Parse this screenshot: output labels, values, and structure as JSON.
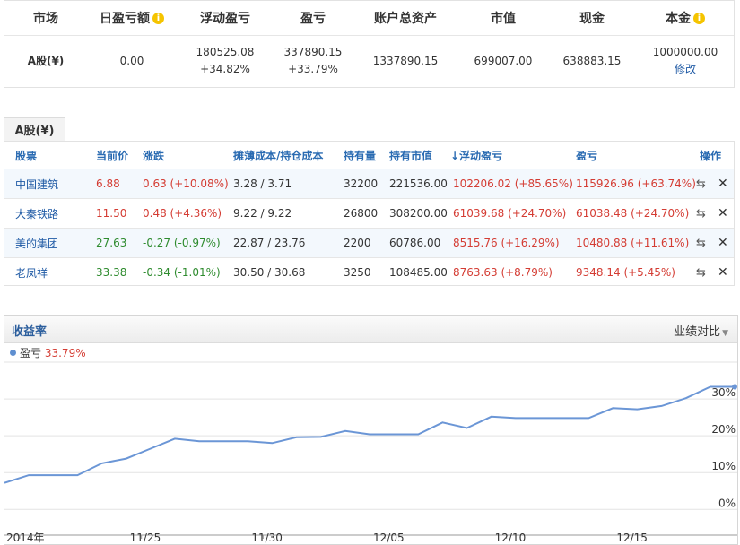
{
  "summary": {
    "headers": {
      "market": "市场",
      "daily_pnl": "日盈亏额",
      "floating_pnl": "浮动盈亏",
      "pnl": "盈亏",
      "total_assets": "账户总资产",
      "market_value": "市值",
      "cash": "现金",
      "principal": "本金"
    },
    "info_icon": "i",
    "row": {
      "market": "A股(¥)",
      "daily_pnl": "0.00",
      "floating_pnl": "180525.08",
      "floating_pnl_pct": "+34.82%",
      "pnl": "337890.15",
      "pnl_pct": "+33.79%",
      "total_assets": "1337890.15",
      "market_value": "699007.00",
      "cash": "638883.15",
      "principal": "1000000.00",
      "edit_link": "修改"
    }
  },
  "holdings": {
    "tab_label": "A股(¥)",
    "columns": {
      "stock": "股票",
      "price": "当前价",
      "change": "涨跌",
      "cost": "摊薄成本/持仓成本",
      "quantity": "持有量",
      "holding_value": "持有市值",
      "floating_pnl": "↓浮动盈亏",
      "pnl": "盈亏",
      "actions": "操作"
    },
    "rows": [
      {
        "stock": "中国建筑",
        "price": "6.88",
        "change": "0.63 (+10.08%)",
        "cost": "3.28 / 3.71",
        "quantity": "32200",
        "holding_value": "221536.00",
        "floating_pnl": "102206.02 (+85.65%)",
        "pnl": "115926.96 (+63.74%)",
        "trend": "up"
      },
      {
        "stock": "大秦铁路",
        "price": "11.50",
        "change": "0.48 (+4.36%)",
        "cost": "9.22 / 9.22",
        "quantity": "26800",
        "holding_value": "308200.00",
        "floating_pnl": "61039.68 (+24.70%)",
        "pnl": "61038.48 (+24.70%)",
        "trend": "up"
      },
      {
        "stock": "美的集团",
        "price": "27.63",
        "change": "-0.27 (-0.97%)",
        "cost": "22.87 / 23.76",
        "quantity": "2200",
        "holding_value": "60786.00",
        "floating_pnl": "8515.76 (+16.29%)",
        "pnl": "10480.88 (+11.61%)",
        "trend": "down"
      },
      {
        "stock": "老凤祥",
        "price": "33.38",
        "change": "-0.34 (-1.01%)",
        "cost": "30.50 / 30.68",
        "quantity": "3250",
        "holding_value": "108485.00",
        "floating_pnl": "8763.63 (+8.79%)",
        "pnl": "9348.14 (+5.45%)",
        "trend": "down"
      }
    ],
    "transfer_icon": "⇆",
    "delete_icon": "✕"
  },
  "chart_panel": {
    "title": "收益率",
    "compare_label": "业绩对比",
    "legend_name": "盈亏",
    "legend_value": "33.79%"
  },
  "chart_data": {
    "type": "line",
    "x_tick_labels": [
      "2014年",
      "11/25",
      "11/30",
      "12/05",
      "12/10",
      "12/15"
    ],
    "y_tick_labels": [
      "0%",
      "10%",
      "20%",
      "30%"
    ],
    "ylim": [
      -7,
      40
    ],
    "grid": true,
    "series": [
      {
        "name": "盈亏",
        "color": "#6b96d6",
        "values": [
          7.2,
          9.3,
          9.3,
          9.3,
          12.5,
          13.8,
          16.5,
          19.2,
          18.5,
          18.5,
          18.5,
          18.0,
          19.6,
          19.7,
          21.3,
          20.4,
          20.4,
          20.4,
          23.6,
          22.1,
          25.2,
          24.8,
          24.8,
          24.8,
          24.8,
          27.5,
          27.2,
          28.1,
          30.2,
          33.3,
          33.3
        ]
      }
    ],
    "colors": {
      "line": "#6b96d6",
      "grid": "#e3e3e3",
      "axis": "#999999"
    }
  }
}
